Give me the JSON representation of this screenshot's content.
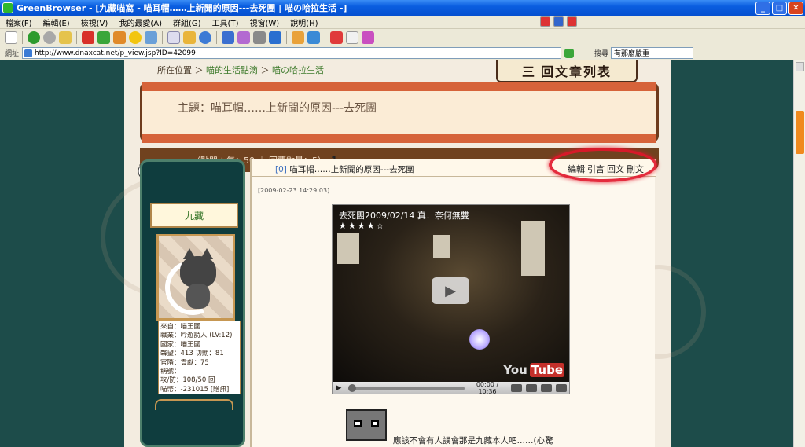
{
  "window": {
    "title": "GreenBrowser - [九藏喵窩 - 喵耳帽……上新聞的原因---去死團 | 喵の哈拉生活 -]"
  },
  "menu": [
    "檔案(F)",
    "編輯(E)",
    "檢視(V)",
    "我的最愛(A)",
    "群組(G)",
    "工具(T)",
    "視窗(W)",
    "說明(H)"
  ],
  "address": {
    "label": "網址",
    "url": "http://www.dnaxcat.net/p_view.jsp?ID=42099",
    "search_label": "搜尋",
    "search_value": "有那麼嚴重"
  },
  "breadcrumb": {
    "prefix": "所在位置 ＞",
    "link1": "喵的生活點滴",
    "sep": "＞",
    "link2": "喵の哈拉生活"
  },
  "banner_sign": {
    "mark": "三",
    "text": "回文章列表"
  },
  "topic": {
    "title": "主題：喵耳帽……上新聞的原因---去死團"
  },
  "stats": {
    "text": "（點閱人氣：50 ｜ 回覆數量：5）",
    "page": "1"
  },
  "user": {
    "name": "九藏",
    "info": [
      "來自：喵王國",
      "職業：吟遊詩人 (LV:12)",
      "國家：喵王國",
      "聲望：413 功勳：81",
      "官階：貢獻：75",
      "稱號：",
      "攻/防：108/50 回",
      "喵幣：-231015 [贈訊]"
    ]
  },
  "post": {
    "title_num": "[0]",
    "title": "喵耳帽……上新聞的原因---去死團",
    "actions": [
      "編輯",
      "引言",
      "回文",
      "刪文"
    ],
    "date": "[2009-02-23 14:29:03]",
    "video": {
      "title": "去死團2009/02/14 真．奈何無雙",
      "stars": "★★★★☆",
      "time": "00:00 / 10:36",
      "logo_a": "You",
      "logo_b": "Tube"
    },
    "body": "應該不會有人誤會那是九藏本人吧……(心驚"
  }
}
